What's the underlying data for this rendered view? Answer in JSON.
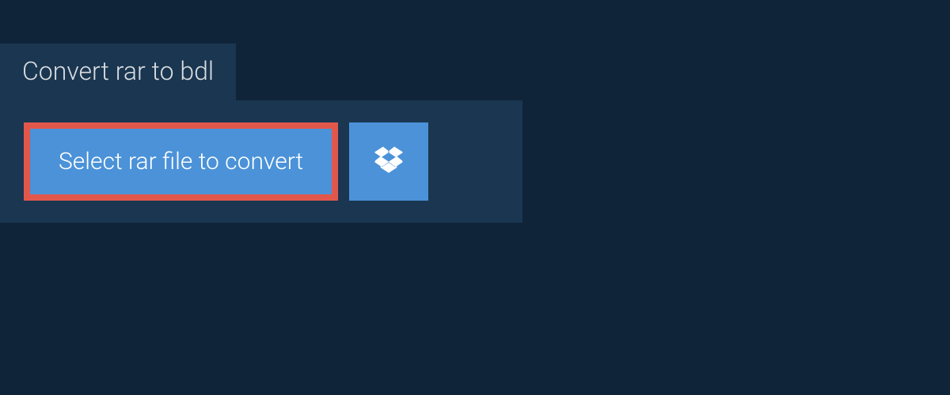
{
  "tab": {
    "title": "Convert rar to bdl"
  },
  "actions": {
    "select_label": "Select rar file to convert",
    "dropbox_icon": "dropbox"
  },
  "colors": {
    "page_bg": "#0f2438",
    "panel_bg": "#1a3651",
    "button_bg": "#4b92d8",
    "highlight_border": "#e2574c",
    "text_light": "#ffffff",
    "tab_text": "#d9dde0"
  }
}
